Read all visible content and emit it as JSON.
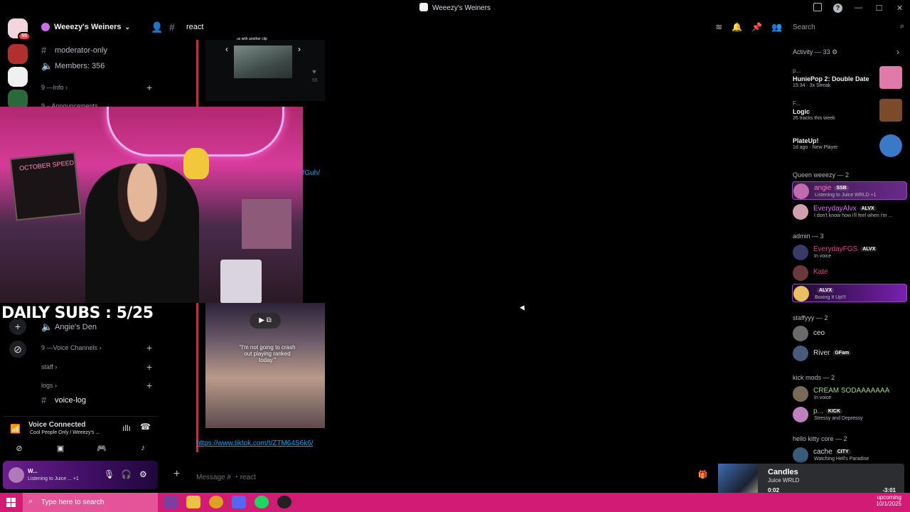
{
  "window": {
    "title": "Weeezy's Weiners"
  },
  "server": {
    "name": "Weeezy's Weiners",
    "rail_badge": "55"
  },
  "channels": {
    "top": [
      {
        "name": "moderator-only",
        "icon": "hash-icon"
      },
      {
        "name": "Members: 356",
        "icon": "speaker-icon"
      }
    ],
    "categories": [
      {
        "label": "9 —Info"
      },
      {
        "label": "9 – Announcements"
      },
      {
        "label": "9 —Voice Channels"
      },
      {
        "label": "staff"
      },
      {
        "label": "logs"
      }
    ],
    "other": [
      {
        "name": "Angie's Den",
        "icon": "speaker-icon"
      },
      {
        "name": "voice-log",
        "icon": "hash-icon"
      }
    ]
  },
  "voice": {
    "title": "Voice Connected",
    "subtitle": "Cool People Only / Weeezy's ..."
  },
  "user": {
    "name": "W...",
    "status": "Listening to Juice ...",
    "status_extra": "+1"
  },
  "chat": {
    "channel": "react",
    "embed_caption": "us with another clip",
    "partial_link": "afGuh/",
    "video_quote": "\"I'm not going to crash out playing ranked today.\"",
    "link": "https://www.tiktok.com/t/ZTM64S6k6/",
    "composer_placeholder": "Message # ・react",
    "likes": "55"
  },
  "overlay": {
    "subs_text": "DAILY SUBS : 5/25",
    "board_text": "OCTOBER SPEED"
  },
  "sidebar": {
    "search_placeholder": "Search",
    "activity_header": "Activity — 33",
    "activities": [
      {
        "who": "p...",
        "game": "HuniePop 2: Double Date",
        "meta": "15:34 · 3x Streak",
        "art_color": "#e07aa8"
      },
      {
        "who": "F...",
        "game": "Logic",
        "meta": "26 tracks this week",
        "art_color": "#7a4a2a"
      },
      {
        "who": "",
        "game": "PlateUp!",
        "meta": "1d ago · New Player",
        "art_color": "#3a78c8"
      }
    ],
    "groups": [
      {
        "label": "Queen weeezy — 2"
      },
      {
        "label": "admin — 3"
      },
      {
        "label": "staffyyy — 2"
      },
      {
        "label": "kick mods — 2"
      },
      {
        "label": "hello kitty core — 2"
      }
    ],
    "members": [
      {
        "name": "angie",
        "tag": "SSB",
        "sub": "Listening to Juice WRLD +1",
        "color": "#ff73c7",
        "ava": "#c06bb0"
      },
      {
        "name": "EverydayAlvx",
        "tag": "ALVX",
        "sub": "I don't know how i'll feel when i'm ...",
        "color": "#e06aff",
        "ava": "#d4a0b0"
      },
      {
        "name": "EverydayFGS",
        "tag": "ALVX",
        "sub": "In voice",
        "color": "#e0408a",
        "ava": "#3a3a6a"
      },
      {
        "name": "Kate",
        "tag": "",
        "sub": "",
        "color": "#e0408a",
        "ava": "#6a3a3a"
      },
      {
        "name": "",
        "tag": "ALVX",
        "sub": "Boxing It Up!!!",
        "color": "#e0408a",
        "ava": "#e8c060"
      },
      {
        "name": "ceo",
        "tag": "",
        "sub": "",
        "color": "#dbdee1",
        "ava": "#6a6a6a"
      },
      {
        "name": "River",
        "tag": "GFam",
        "sub": "",
        "color": "#dbdee1",
        "ava": "#4a5a7a"
      },
      {
        "name": "CREAM SODAAAAAAA",
        "tag": "",
        "sub": "In voice",
        "color": "#9bd67a",
        "ava": "#7a6a5a"
      },
      {
        "name": "p...",
        "tag": "KICK",
        "sub": "Stressy and Depressy",
        "color": "#9bd67a",
        "ava": "#c080c0"
      },
      {
        "name": "cache",
        "tag": "CITY",
        "sub": "Watching Hell's Paradise",
        "color": "#dbdee1",
        "ava": "#3a5a7a"
      }
    ]
  },
  "now_playing": {
    "title": "Candles",
    "artist": "Juice WRLD",
    "current": "0:02",
    "length": "-3:01",
    "progress": 0.01
  },
  "taskbar": {
    "search_placeholder": "Type here to search",
    "date": "10/1/2025",
    "upcoming": "upcoming"
  },
  "colors": {
    "accent": "#d21b74",
    "link": "#00a8fc",
    "embed_bar": "#d1293b"
  }
}
